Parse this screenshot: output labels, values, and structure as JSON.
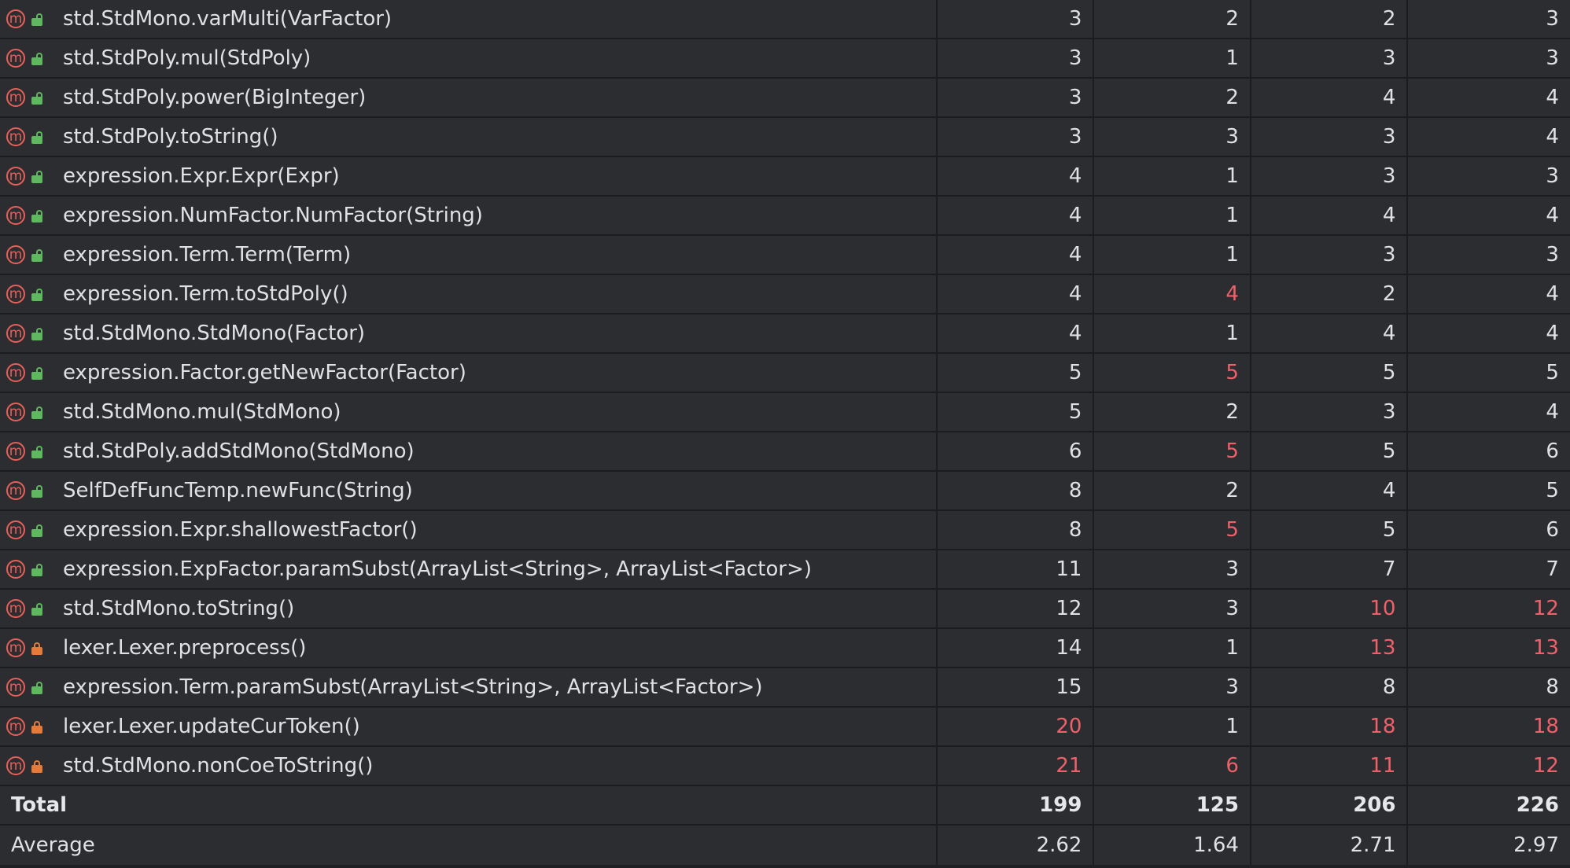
{
  "rows": [
    {
      "name": "std.StdMono.varMulti(VarFactor)",
      "access": "public",
      "values": [
        "3",
        "2",
        "2",
        "3"
      ],
      "red": [
        false,
        false,
        false,
        false
      ]
    },
    {
      "name": "std.StdPoly.mul(StdPoly)",
      "access": "public",
      "values": [
        "3",
        "1",
        "3",
        "3"
      ],
      "red": [
        false,
        false,
        false,
        false
      ]
    },
    {
      "name": "std.StdPoly.power(BigInteger)",
      "access": "public",
      "values": [
        "3",
        "2",
        "4",
        "4"
      ],
      "red": [
        false,
        false,
        false,
        false
      ]
    },
    {
      "name": "std.StdPoly.toString()",
      "access": "public",
      "values": [
        "3",
        "3",
        "3",
        "4"
      ],
      "red": [
        false,
        false,
        false,
        false
      ]
    },
    {
      "name": "expression.Expr.Expr(Expr)",
      "access": "public",
      "values": [
        "4",
        "1",
        "3",
        "3"
      ],
      "red": [
        false,
        false,
        false,
        false
      ]
    },
    {
      "name": "expression.NumFactor.NumFactor(String)",
      "access": "public",
      "values": [
        "4",
        "1",
        "4",
        "4"
      ],
      "red": [
        false,
        false,
        false,
        false
      ]
    },
    {
      "name": "expression.Term.Term(Term)",
      "access": "public",
      "values": [
        "4",
        "1",
        "3",
        "3"
      ],
      "red": [
        false,
        false,
        false,
        false
      ]
    },
    {
      "name": "expression.Term.toStdPoly()",
      "access": "public",
      "values": [
        "4",
        "4",
        "2",
        "4"
      ],
      "red": [
        false,
        true,
        false,
        false
      ]
    },
    {
      "name": "std.StdMono.StdMono(Factor)",
      "access": "public",
      "values": [
        "4",
        "1",
        "4",
        "4"
      ],
      "red": [
        false,
        false,
        false,
        false
      ]
    },
    {
      "name": "expression.Factor.getNewFactor(Factor)",
      "access": "public",
      "values": [
        "5",
        "5",
        "5",
        "5"
      ],
      "red": [
        false,
        true,
        false,
        false
      ]
    },
    {
      "name": "std.StdMono.mul(StdMono)",
      "access": "public",
      "values": [
        "5",
        "2",
        "3",
        "4"
      ],
      "red": [
        false,
        false,
        false,
        false
      ]
    },
    {
      "name": "std.StdPoly.addStdMono(StdMono)",
      "access": "public",
      "values": [
        "6",
        "5",
        "5",
        "6"
      ],
      "red": [
        false,
        true,
        false,
        false
      ]
    },
    {
      "name": "SelfDefFuncTemp.newFunc(String)",
      "access": "public",
      "values": [
        "8",
        "2",
        "4",
        "5"
      ],
      "red": [
        false,
        false,
        false,
        false
      ]
    },
    {
      "name": "expression.Expr.shallowestFactor()",
      "access": "public",
      "values": [
        "8",
        "5",
        "5",
        "6"
      ],
      "red": [
        false,
        true,
        false,
        false
      ]
    },
    {
      "name": "expression.ExpFactor.paramSubst(ArrayList<String>, ArrayList<Factor>)",
      "access": "public",
      "values": [
        "11",
        "3",
        "7",
        "7"
      ],
      "red": [
        false,
        false,
        false,
        false
      ]
    },
    {
      "name": "std.StdMono.toString()",
      "access": "public",
      "values": [
        "12",
        "3",
        "10",
        "12"
      ],
      "red": [
        false,
        false,
        true,
        true
      ]
    },
    {
      "name": "lexer.Lexer.preprocess()",
      "access": "private",
      "values": [
        "14",
        "1",
        "13",
        "13"
      ],
      "red": [
        false,
        false,
        true,
        true
      ]
    },
    {
      "name": "expression.Term.paramSubst(ArrayList<String>, ArrayList<Factor>)",
      "access": "public",
      "values": [
        "15",
        "3",
        "8",
        "8"
      ],
      "red": [
        false,
        false,
        false,
        false
      ]
    },
    {
      "name": "lexer.Lexer.updateCurToken()",
      "access": "private",
      "values": [
        "20",
        "1",
        "18",
        "18"
      ],
      "red": [
        true,
        false,
        true,
        true
      ]
    },
    {
      "name": "std.StdMono.nonCoeToString()",
      "access": "private",
      "values": [
        "21",
        "6",
        "11",
        "12"
      ],
      "red": [
        true,
        true,
        true,
        true
      ]
    }
  ],
  "total": {
    "label": "Total",
    "values": [
      "199",
      "125",
      "206",
      "226"
    ]
  },
  "average": {
    "label": "Average",
    "values": [
      "2.62",
      "1.64",
      "2.71",
      "2.97"
    ]
  },
  "icons": {
    "method": "m",
    "method_icon_name": "method-icon",
    "lock_icon_name": "lock-icon"
  },
  "colors": {
    "background": "#2b2d30",
    "grid": "#1b1c1e",
    "text": "#dfe1e5",
    "highlight_red": "#f0606a",
    "method_icon": "#e8605a",
    "public_lock": "#5fb85f",
    "private_lock": "#e57b3a"
  }
}
